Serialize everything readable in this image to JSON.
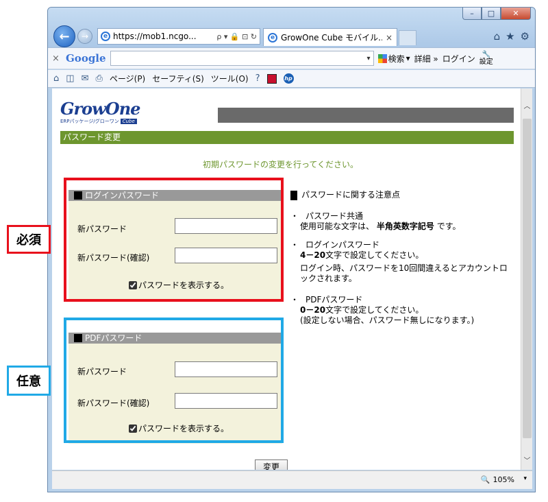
{
  "browser": {
    "address_url": "https://mob1.ncgo...",
    "address_icons": "ρ ▾ 🔒 ⊡ ↻",
    "tab_title": "GrowOne Cube モバイル...",
    "tab_close": "×",
    "top_icons": [
      "⌂",
      "★",
      "⚙"
    ],
    "window_controls": [
      "–",
      "□",
      "✕"
    ]
  },
  "google_toolbar": {
    "close": "×",
    "logo": "Google",
    "dropdown_caret": "▾",
    "search_label": "検索",
    "more_label": "詳細 »",
    "login_label": "ログイン",
    "settings_label": "設定"
  },
  "command_bar": {
    "home_icon": "⌂",
    "feed_icon": "◫",
    "mail_icon": "✉",
    "print_icon": "⎙",
    "page_label": "ページ(P)",
    "safety_label": "セーフティ(S)",
    "tools_label": "ツール(O)",
    "help_icon": "?",
    "hp_icon": "hp",
    "caret": "▾"
  },
  "page": {
    "logo_text": "GrowOne",
    "logo_sub": "ERPパッケージ/グローワン",
    "logo_cube": "Cube",
    "title": "パスワード変更",
    "instruction": "初期パスワードの変更を行ってください。",
    "login_panel": {
      "title": "ログインパスワード",
      "new_label": "新パスワード",
      "confirm_label": "新パスワード(確認)",
      "new_value": "",
      "confirm_value": "",
      "show_label": "パスワードを表示する。",
      "show_checked": true
    },
    "pdf_panel": {
      "title": "PDFパスワード",
      "new_label": "新パスワード",
      "confirm_label": "新パスワード(確認)",
      "new_value": "",
      "confirm_value": "",
      "show_label": "パスワードを表示する。",
      "show_checked": true
    },
    "notes": {
      "title": "パスワードに関する注意点",
      "bullet": "・",
      "common_head": "パスワード共通",
      "common_body_prefix": "使用可能な文字は、",
      "common_body_bold": "半角英数字記号",
      "common_body_suffix": "です。",
      "login_head": "ログインパスワード",
      "login_range": "4－20",
      "login_range_suffix": "文字で設定してください。",
      "login_lock": "ログイン時、パスワードを10回間違えるとアカウントロックされます。",
      "pdf_head": "PDFパスワード",
      "pdf_range": "0－20",
      "pdf_range_suffix": "文字で設定してください。",
      "pdf_note": "(設定しない場合、パスワード無しになります。)"
    },
    "submit_label": "変更"
  },
  "status": {
    "zoom": "105%",
    "zoom_icon": "🔍",
    "caret": "▾"
  },
  "annotations": {
    "required": "必須",
    "optional": "任意"
  },
  "colors": {
    "accent_green": "#6d962e",
    "required_red": "#e8101c",
    "optional_blue": "#20a9e6"
  }
}
